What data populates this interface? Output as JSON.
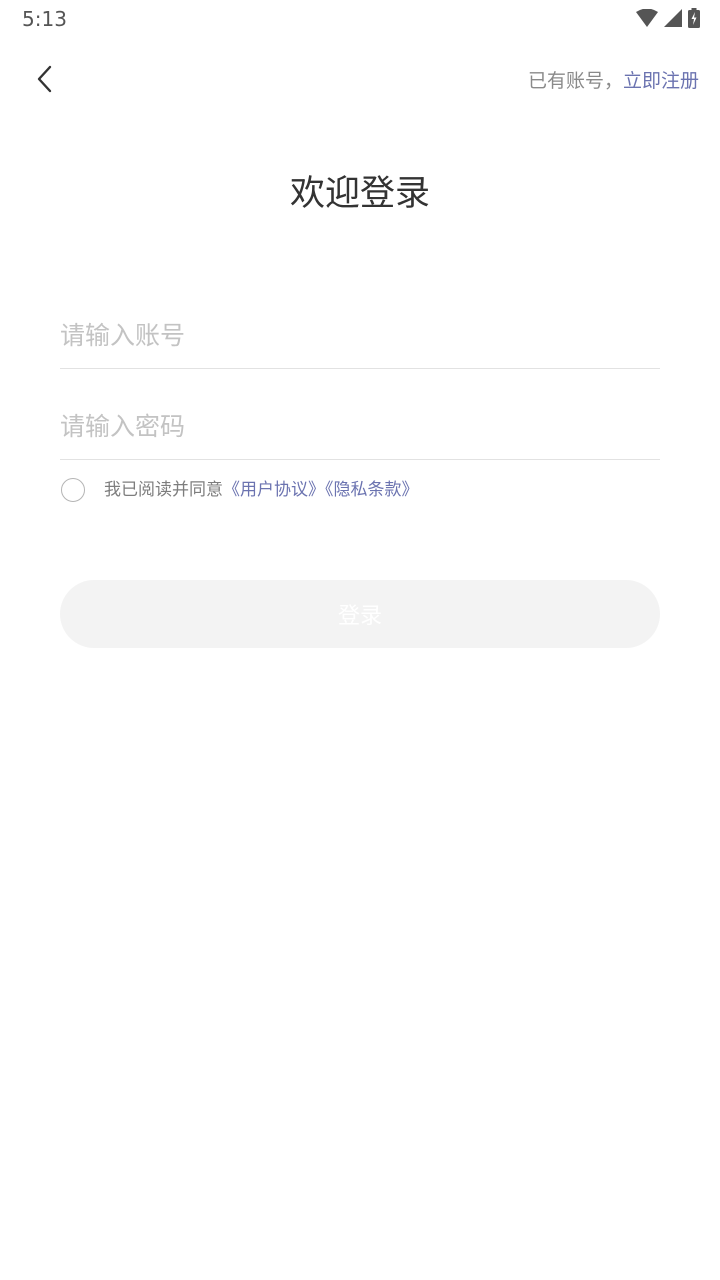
{
  "status_bar": {
    "time": "5:13",
    "icons": [
      "wifi-icon",
      "cell-signal-icon",
      "battery-charging-icon"
    ]
  },
  "nav": {
    "back_icon": "chevron-left-icon",
    "account_hint": "已有账号，",
    "register_link": "立即注册"
  },
  "title": "欢迎登录",
  "form": {
    "account_placeholder": "请输入账号",
    "account_value": "",
    "password_placeholder": "请输入密码",
    "password_value": ""
  },
  "agreement": {
    "checked": false,
    "prefix": "我已阅读并同意",
    "user_agreement": "《用户协议》",
    "privacy_policy": "《隐私条款》"
  },
  "login_button": "登录",
  "colors": {
    "link": "#6b73b0",
    "placeholder": "#c3c3c3",
    "button_disabled_bg": "#f3f3f3",
    "title": "#333333"
  }
}
